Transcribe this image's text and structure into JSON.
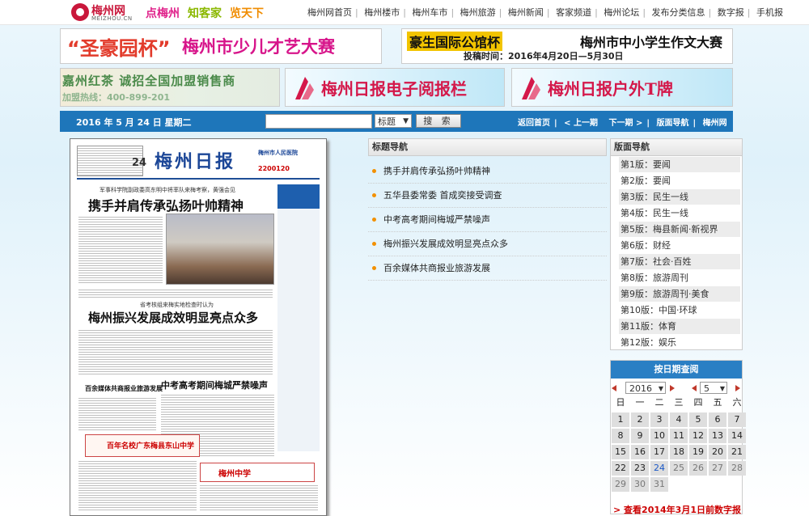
{
  "site": {
    "logo_name": "梅州网",
    "logo_domain": "MEIZHOU.CN",
    "slogans": [
      {
        "text": "点梅州",
        "color": "#e0218a"
      },
      {
        "text": "知客家",
        "color": "#8ab800"
      },
      {
        "text": "览天下",
        "color": "#f08c00"
      }
    ],
    "top_nav": [
      "梅州网首页",
      "梅州楼市",
      "梅州车市",
      "梅州旅游",
      "梅州新闻",
      "客家频道",
      "梅州论坛",
      "发布分类信息",
      "数字报",
      "手机报"
    ]
  },
  "banners": {
    "b1_left": "“圣豪园杯”",
    "b1_right": "梅州市少儿才艺大赛",
    "b2_left": "豪生国际公馆杯",
    "b2_right": "梅州市中小学生作文大赛",
    "b2_sub": "投稿时间：2016年4月20日—5月30日",
    "b3_line1": "嘉州红茶 诚招全国加盟销售商",
    "b3_line2": "加盟热线：400-899-201",
    "b4": "梅州日报电子阅报栏",
    "b5": "梅州日报户外T牌"
  },
  "searchbar": {
    "date": "2016 年 5 月 24 日   星期二",
    "input_value": "",
    "select_value": "标题",
    "search_button": "搜 索",
    "nav": [
      "返回首页",
      "< 上一期",
      "下一期 >",
      "版面导航",
      "梅州网"
    ]
  },
  "newspaper": {
    "issue_no": "24",
    "masthead": "梅州日报",
    "hospital": "梅州市人民医院",
    "hospital_phone": "2200120",
    "kicker1": "军事科学院副政委高东明中将率队来梅考察，黄强会见",
    "headline1": "携手并肩传承弘扬叶帅精神",
    "kicker2": "省考核组来梅实地检查时认为",
    "headline2": "梅州振兴发展成效明显亮点众多",
    "headline3": "中考高考期间梅城严禁噪声",
    "headline4": "百余媒体共商报业旅游发展",
    "ad1": "百年名校广东梅县东山中学",
    "ad2": "梅州中学"
  },
  "title_nav": {
    "heading": "标题导航",
    "items": [
      "携手并肩传承弘扬叶帅精神",
      "五华县委常委 首成奕接受调查",
      "中考高考期间梅城严禁噪声",
      "梅州振兴发展成效明显亮点众多",
      "百余媒体共商报业旅游发展"
    ],
    "bullet_color": "#f29000"
  },
  "page_nav": {
    "heading": "版面导航",
    "items": [
      "第1版：要闻",
      "第2版：要闻",
      "第3版：民生一线",
      "第4版：民生一线",
      "第5版：梅县新闻·新视界",
      "第6版：财经",
      "第7版：社会·百姓",
      "第8版：旅游周刊",
      "第9版：旅游周刊·美食",
      "第10版：中国·环球",
      "第11版：体育",
      "第12版：娱乐"
    ]
  },
  "date_query": {
    "title": "按日期查阅",
    "year": "2016",
    "month": "5",
    "weekdays": [
      "日",
      "一",
      "二",
      "三",
      "四",
      "五",
      "六"
    ],
    "days": [
      "1",
      "2",
      "3",
      "4",
      "5",
      "6",
      "7",
      "8",
      "9",
      "10",
      "11",
      "12",
      "13",
      "14",
      "15",
      "16",
      "17",
      "18",
      "19",
      "20",
      "21",
      "22",
      "23",
      "24",
      "25",
      "26",
      "27",
      "28",
      "29",
      "30",
      "31"
    ],
    "today": "24",
    "archive_link": "> 查看2014年3月1日前数字报"
  },
  "colors": {
    "brand_red": "#c9173b",
    "bar_blue": "#1e76ba",
    "query_blue": "#2a7fc4"
  }
}
